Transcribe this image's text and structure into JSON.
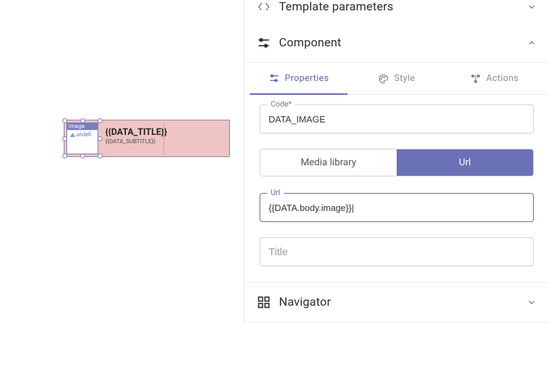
{
  "canvas": {
    "image_slot_label": "image",
    "image_slot_text": "undefi",
    "title": "{{DATA_TITLE}}",
    "subtitle": "{{DATA_SUBTITLE}}"
  },
  "panel": {
    "template_params_title": "Template parameters",
    "component_title": "Component",
    "navigator_title": "Navigator",
    "tabs": {
      "properties": "Properties",
      "style": "Style",
      "actions": "Actions"
    },
    "fields": {
      "code_label": "Code*",
      "code_value": "DATA_IMAGE",
      "media_library": "Media library",
      "url_toggle": "Url",
      "url_label": "Url",
      "url_value": "{{DATA.body.image}}|",
      "title_placeholder": "Title",
      "title_value": ""
    }
  }
}
